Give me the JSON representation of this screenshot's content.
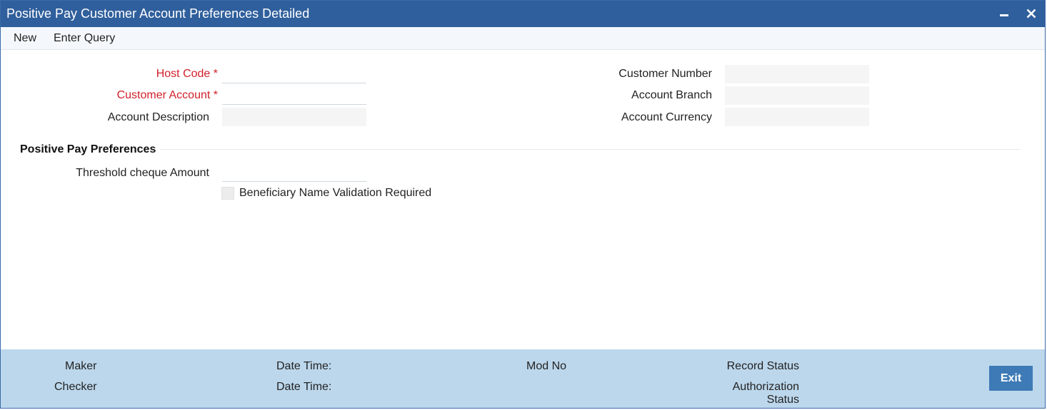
{
  "window": {
    "title": "Positive Pay Customer Account Preferences Detailed",
    "minimize_glyph": "−",
    "close_glyph": "✕"
  },
  "menu": {
    "new_label": "New",
    "enter_query_label": "Enter Query"
  },
  "form": {
    "host_code_label": "Host Code",
    "customer_account_label": "Customer Account",
    "account_description_label": "Account Description",
    "customer_number_label": "Customer Number",
    "account_branch_label": "Account Branch",
    "account_currency_label": "Account Currency",
    "required_marker": "*",
    "host_code_value": "",
    "customer_account_value": "",
    "account_description_value": "",
    "customer_number_value": "",
    "account_branch_value": "",
    "account_currency_value": ""
  },
  "preferences": {
    "section_title": "Positive Pay Preferences",
    "threshold_label": "Threshold cheque Amount",
    "threshold_value": "",
    "beneficiary_label": "Beneficiary Name Validation Required",
    "beneficiary_checked": false
  },
  "footer": {
    "maker_label": "Maker",
    "checker_label": "Checker",
    "date_time_label_1": "Date Time:",
    "date_time_label_2": "Date Time:",
    "mod_no_label": "Mod No",
    "record_status_label": "Record Status",
    "authorization_label": "Authorization",
    "status_label": "Status",
    "exit_label": "Exit"
  },
  "colors": {
    "titlebar": "#2f5f9c",
    "required": "#d0202a",
    "footer": "#bcd7ec",
    "exit_button": "#3d7ab6"
  }
}
